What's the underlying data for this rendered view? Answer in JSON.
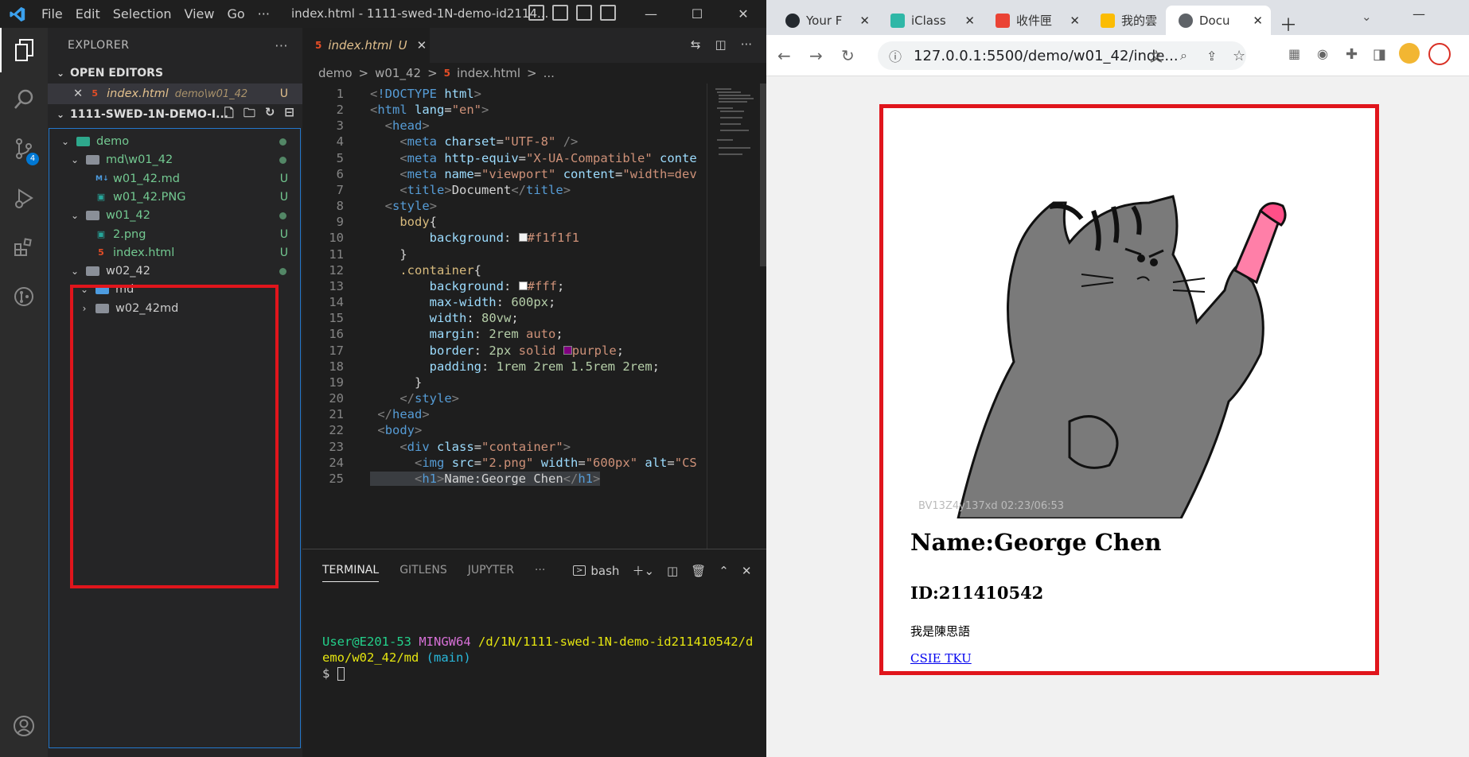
{
  "vscode": {
    "menu": [
      "File",
      "Edit",
      "Selection",
      "View",
      "Go",
      "···"
    ],
    "title": "index.html - 1111-swed-1N-demo-id2114...",
    "explorer_title": "EXPLORER",
    "open_editors_label": "OPEN EDITORS",
    "open_editor": {
      "name": "index.html",
      "path": "demo\\w01_42",
      "status": "U"
    },
    "workspace_label": "1111-SWED-1N-DEMO-I...",
    "tree": [
      {
        "label": "demo",
        "indent": 0,
        "type": "folder-open"
      },
      {
        "label": "md\\w01_42",
        "indent": 1,
        "type": "folder-open"
      },
      {
        "label": "w01_42.md",
        "indent": 2,
        "type": "md",
        "status": "U"
      },
      {
        "label": "w01_42.PNG",
        "indent": 2,
        "type": "img",
        "status": "U"
      },
      {
        "label": "w01_42",
        "indent": 1,
        "type": "folder-open"
      },
      {
        "label": "2.png",
        "indent": 2,
        "type": "img",
        "status": "U"
      },
      {
        "label": "index.html",
        "indent": 2,
        "type": "html",
        "status": "U"
      },
      {
        "label": "w02_42",
        "indent": 1,
        "type": "folder-open"
      },
      {
        "label": "md",
        "indent": 2,
        "type": "folder-md"
      },
      {
        "label": "w02_42md",
        "indent": 2,
        "type": "folder-closed"
      }
    ],
    "source_control_badge": "4",
    "tab": {
      "name": "index.html",
      "status": "U"
    },
    "breadcrumb": [
      "demo",
      ">",
      "w01_42",
      ">",
      "index.html",
      ">",
      "..."
    ],
    "line_numbers": [
      "1",
      "2",
      "3",
      "4",
      "5",
      "6",
      "7",
      "8",
      "9",
      "10",
      "11",
      "12",
      "13",
      "14",
      "15",
      "16",
      "17",
      "18",
      "19",
      "20",
      "21",
      "22",
      "23",
      "24",
      "25"
    ],
    "panel_tabs": [
      "TERMINAL",
      "GITLENS",
      "JUPYTER",
      "···"
    ],
    "terminal_shell": "bash",
    "terminal": {
      "user": "User@E201-53",
      "env": "MINGW64",
      "path": "/d/1N/1111-swed-1N-demo-id211410542/d",
      "path2": "emo/w02_42/md",
      "branch": "(main)",
      "prompt": "$"
    }
  },
  "browser": {
    "tabs": [
      {
        "label": "Your F",
        "icon": "github-icon"
      },
      {
        "label": "iClass",
        "icon": "iclass-icon"
      },
      {
        "label": "收件匣",
        "icon": "gmail-icon"
      },
      {
        "label": "我的雲",
        "icon": "drive-icon"
      },
      {
        "label": "Docu",
        "icon": "globe-icon",
        "active": true
      }
    ],
    "url": "127.0.0.1:5500/demo/w01_42/inde...",
    "page": {
      "h1": "Name:George Chen",
      "h2": "ID:211410542",
      "p": "我是陳思語",
      "link": "CSIE TKU",
      "watermark": "BV13Z4y137xd 02:23/06:53"
    }
  }
}
